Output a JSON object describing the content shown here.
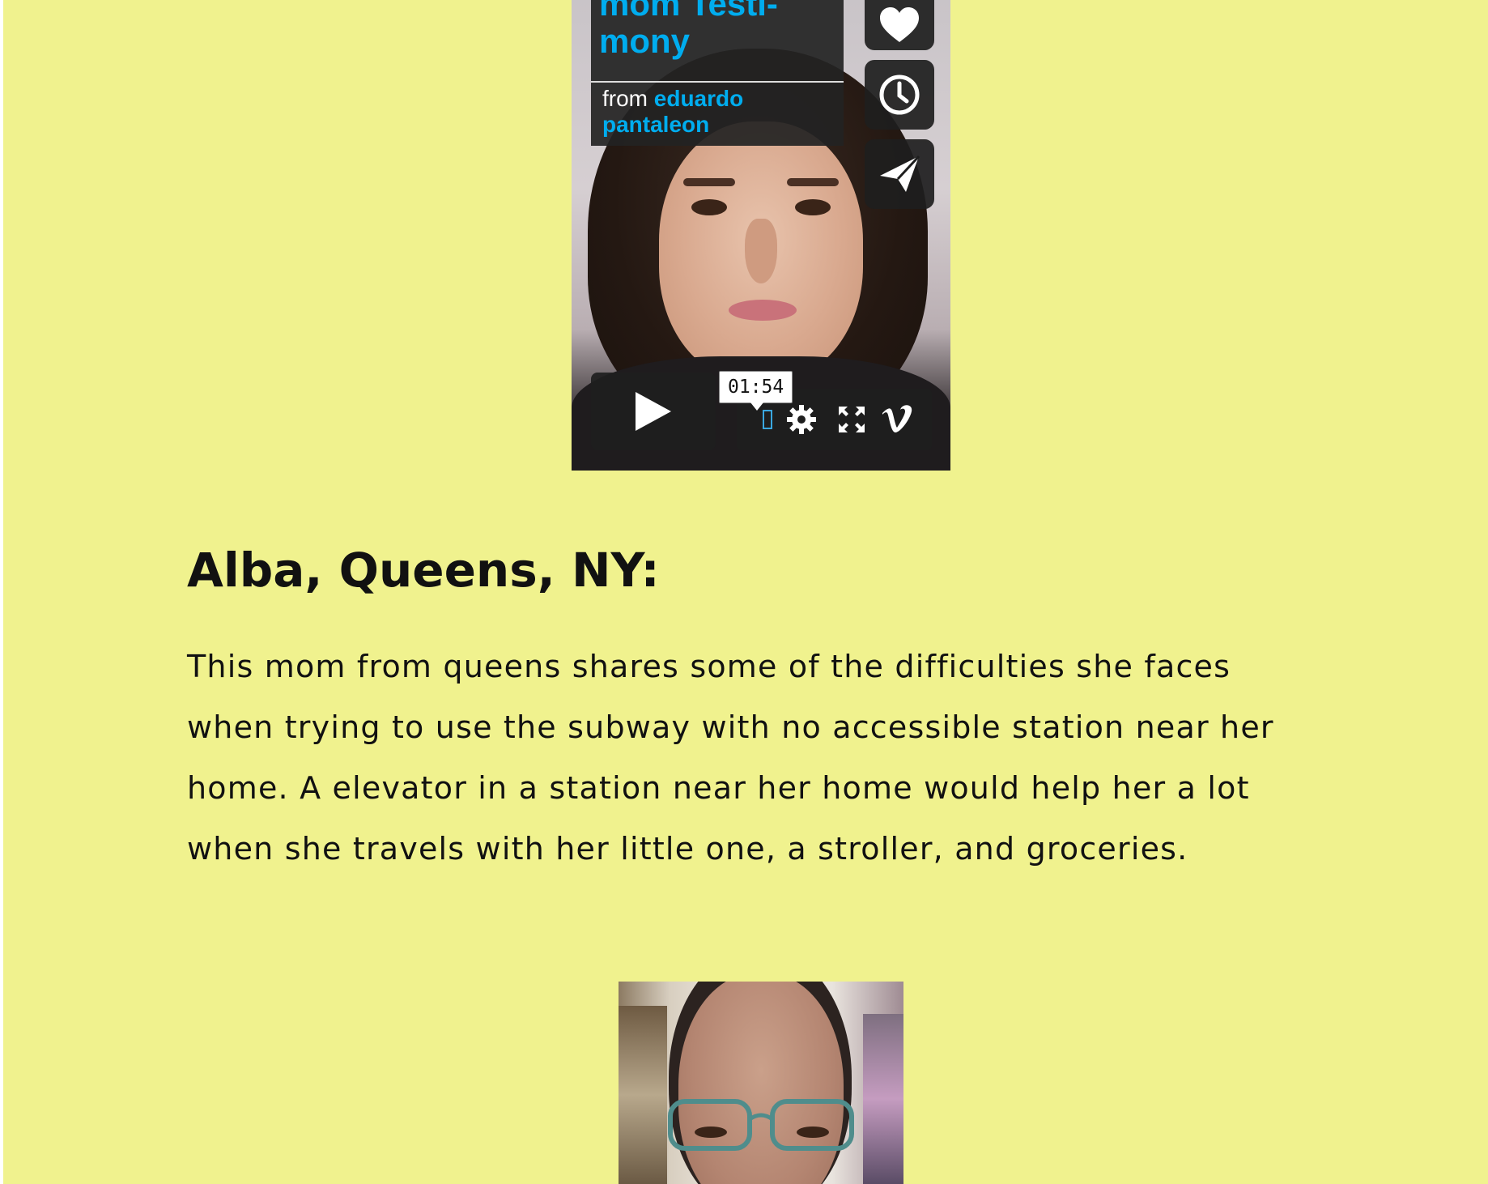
{
  "video1": {
    "title_line1": "mom Testi-",
    "title_line2": "mony",
    "from_label": "from",
    "author_line1": "eduardo",
    "author_line2": "pantaleon",
    "time_tooltip": "01:54",
    "icons": [
      "heart-icon",
      "clock-icon",
      "paper-plane-icon",
      "play-icon",
      "gear-icon",
      "fullscreen-icon",
      "vimeo-logo-icon"
    ],
    "accent_color": "#00adef"
  },
  "section": {
    "heading": "Alba, Queens, NY:",
    "description": "This mom from queens shares some of the difficulties she faces when trying to use the subway with no accessible station near her home. A elevator in a station near her home would help her a lot when she travels with her little one, a stroller, and groceries."
  },
  "colors": {
    "page_background": "#f0f28e",
    "player_control_bg": "#1e1e1e"
  }
}
